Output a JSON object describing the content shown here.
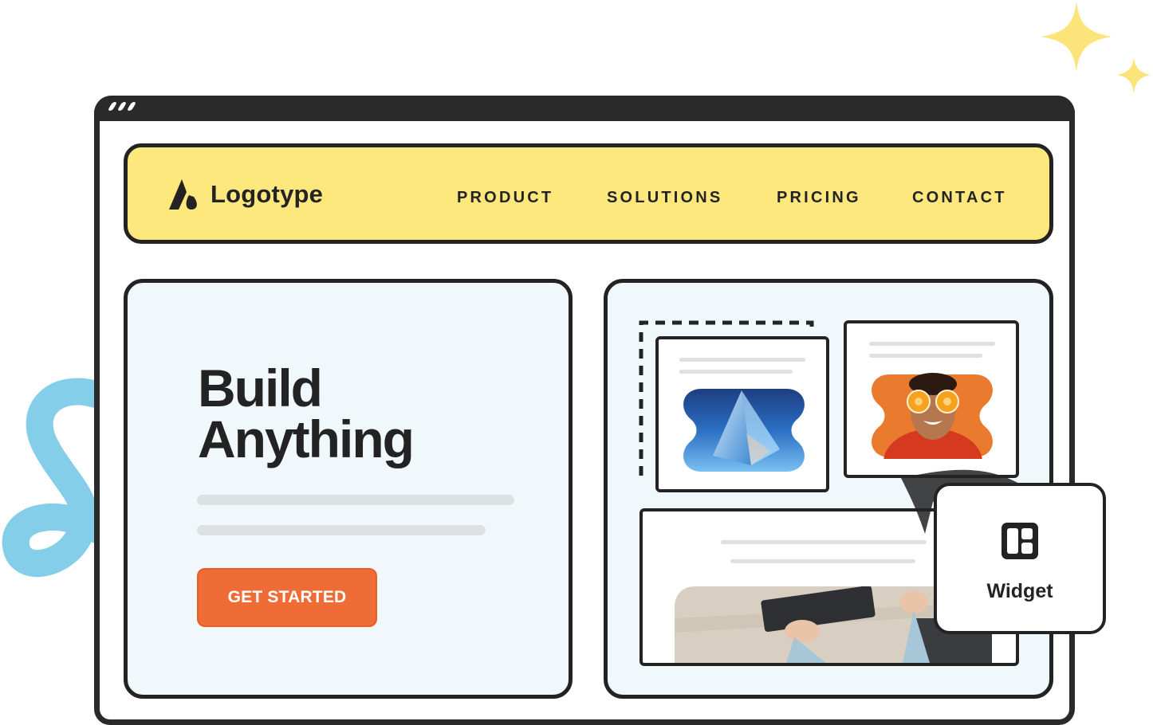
{
  "brand": {
    "logo_text": "Logotype"
  },
  "nav": {
    "items": [
      {
        "label": "PRODUCT"
      },
      {
        "label": "SOLUTIONS"
      },
      {
        "label": "PRICING"
      },
      {
        "label": "CONTACT"
      }
    ]
  },
  "hero": {
    "title_line1": "Build",
    "title_line2": "Anything",
    "cta_label": "GET STARTED"
  },
  "widget": {
    "label": "Widget",
    "icon": "layout-grid-icon"
  },
  "images": [
    "glass-prism-image",
    "woman-with-orange-slices-image",
    "hands-typing-on-keyboard-image"
  ],
  "colors": {
    "nav_background": "#fde87e",
    "cta": "#f06c36",
    "panel_background": "#f1f8fb",
    "outline": "#232323",
    "swirl": "#7dcbe8",
    "sparkle": "#fbe57a"
  }
}
